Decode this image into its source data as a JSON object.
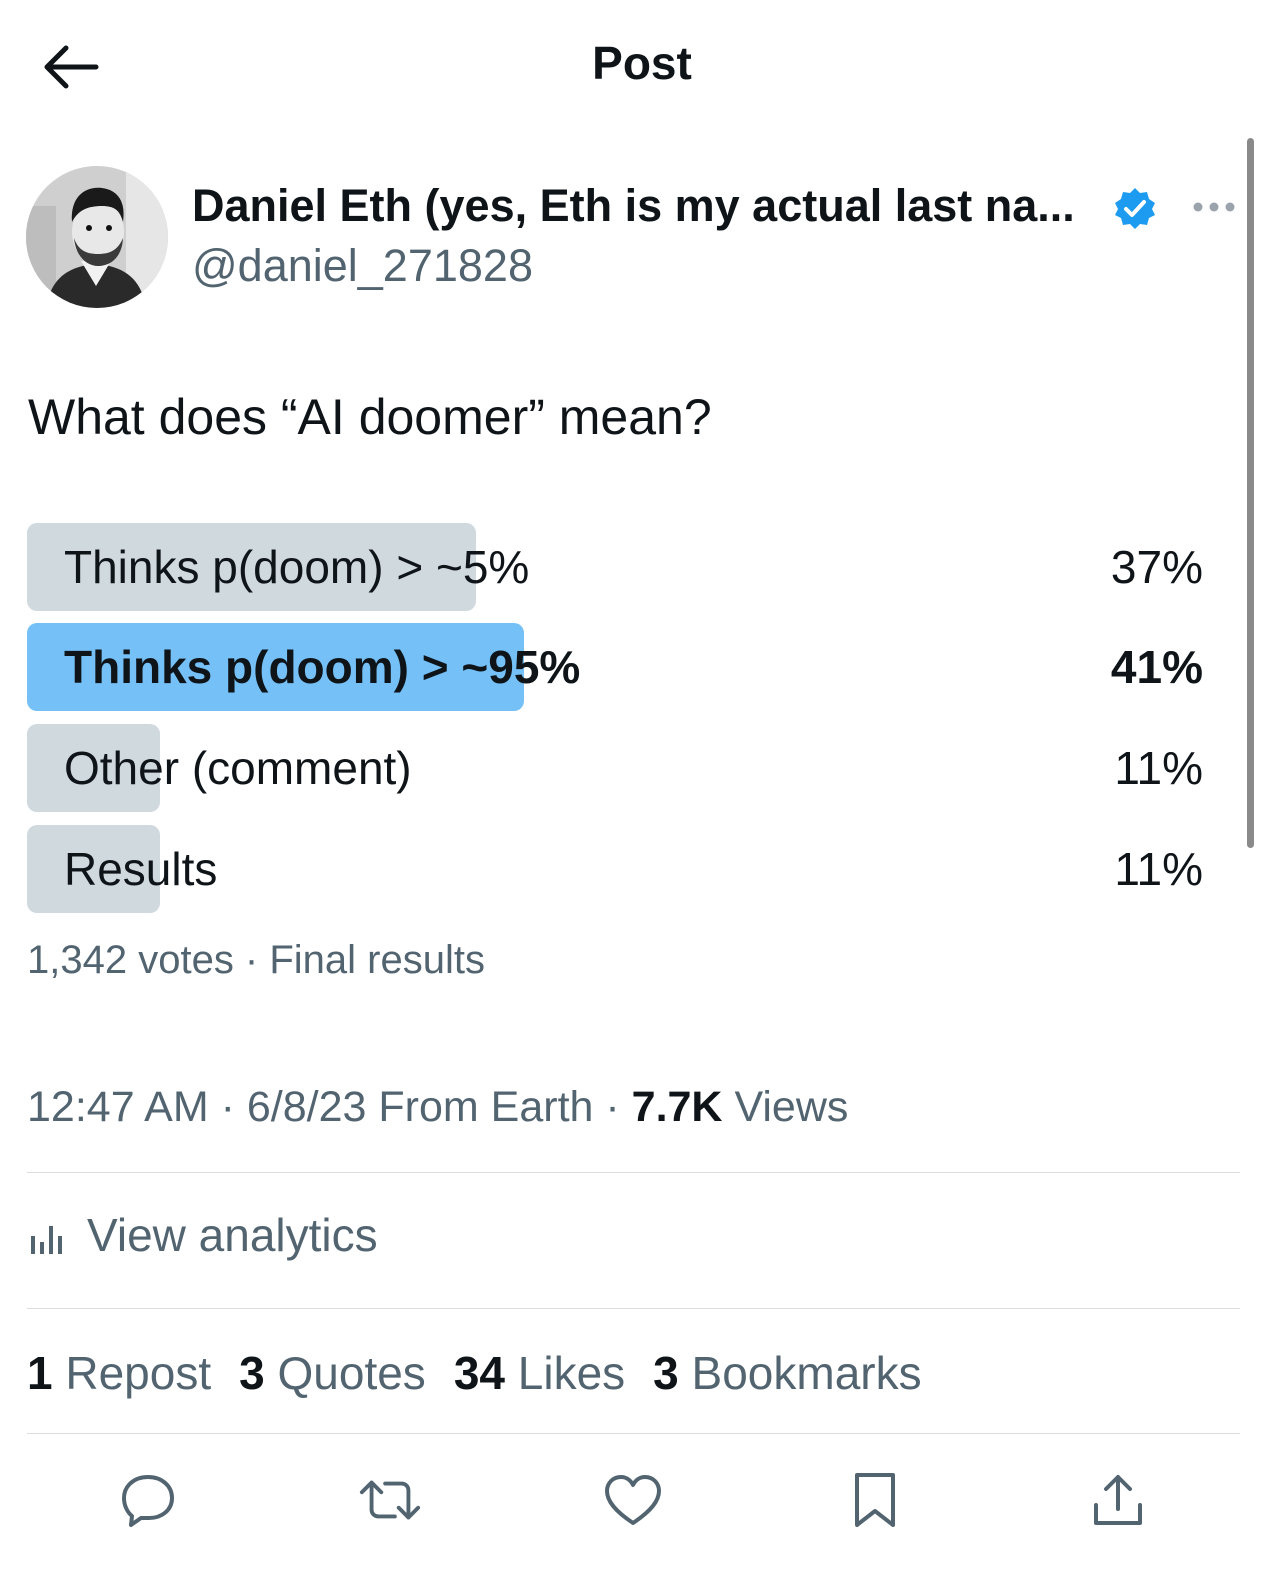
{
  "header": {
    "title": "Post",
    "back_icon": "arrow-left-icon"
  },
  "author": {
    "name": "Daniel Eth (yes, Eth is my actual last na...",
    "handle": "@daniel_271828",
    "verified": true,
    "avatar": "avatar-image"
  },
  "post": {
    "text": "What does “AI doomer” mean?"
  },
  "poll": {
    "options": [
      {
        "label": "Thinks p(doom) > ~5%",
        "percent_text": "37%",
        "percent": 37,
        "winner": false
      },
      {
        "label": "Thinks p(doom) > ~95%",
        "percent_text": "41%",
        "percent": 41,
        "winner": true
      },
      {
        "label": "Other (comment)",
        "percent_text": "11%",
        "percent": 11,
        "winner": false
      },
      {
        "label": "Results",
        "percent_text": "11%",
        "percent": 11,
        "winner": false
      }
    ],
    "meta": "1,342 votes · Final results"
  },
  "timestamp": {
    "time_date_source": "12:47 AM · 6/8/23 From Earth · ",
    "views_count": "7.7K",
    "views_label": " Views"
  },
  "analytics": {
    "label": "View analytics"
  },
  "stats": {
    "reposts_count": "1",
    "reposts_label": "Repost",
    "quotes_count": "3",
    "quotes_label": "Quotes",
    "likes_count": "34",
    "likes_label": "Likes",
    "bookmarks_count": "3",
    "bookmarks_label": "Bookmarks"
  },
  "colors": {
    "accent": "#1d9bf0",
    "winner_bar": "#74c0f7",
    "bar": "#cfd9de",
    "secondary_text": "#536471"
  }
}
